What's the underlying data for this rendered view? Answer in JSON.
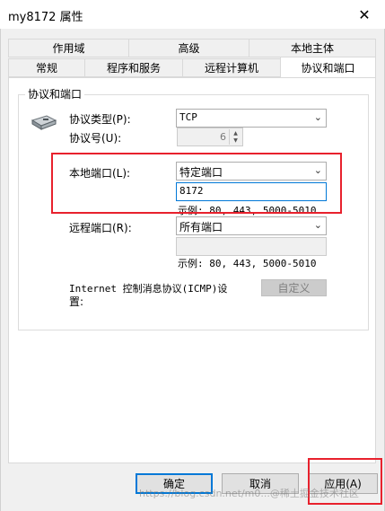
{
  "window": {
    "title": "my8172 属性",
    "close_glyph": "✕"
  },
  "tabs": {
    "row1": [
      "作用域",
      "高级",
      "本地主体"
    ],
    "row2": [
      "常规",
      "程序和服务",
      "远程计算机",
      "协议和端口"
    ],
    "active": "协议和端口"
  },
  "group": {
    "label": "协议和端口"
  },
  "protocol": {
    "type_label": "协议类型(P):",
    "type_value": "TCP",
    "number_label": "协议号(U):",
    "number_value": "6"
  },
  "local_port": {
    "label": "本地端口(L):",
    "combo_value": "特定端口",
    "text_value": "8172",
    "example": "示例: 80, 443, 5000-5010"
  },
  "remote_port": {
    "label": "远程端口(R):",
    "combo_value": "所有端口",
    "text_value": "",
    "example": "示例: 80, 443, 5000-5010"
  },
  "icmp": {
    "label_line1": "Internet 控制消息协议(ICMP)设",
    "label_line2": "置:",
    "button": "自定义"
  },
  "buttons": {
    "ok": "确定",
    "cancel": "取消",
    "apply": "应用(A)"
  },
  "watermark": "https://blog.csdn.net/m0...@稀土掘金技术社区",
  "colors": {
    "highlight_red": "#e8212d",
    "focus_blue": "#0078d7",
    "dialog_bg": "#f0f0f0"
  }
}
